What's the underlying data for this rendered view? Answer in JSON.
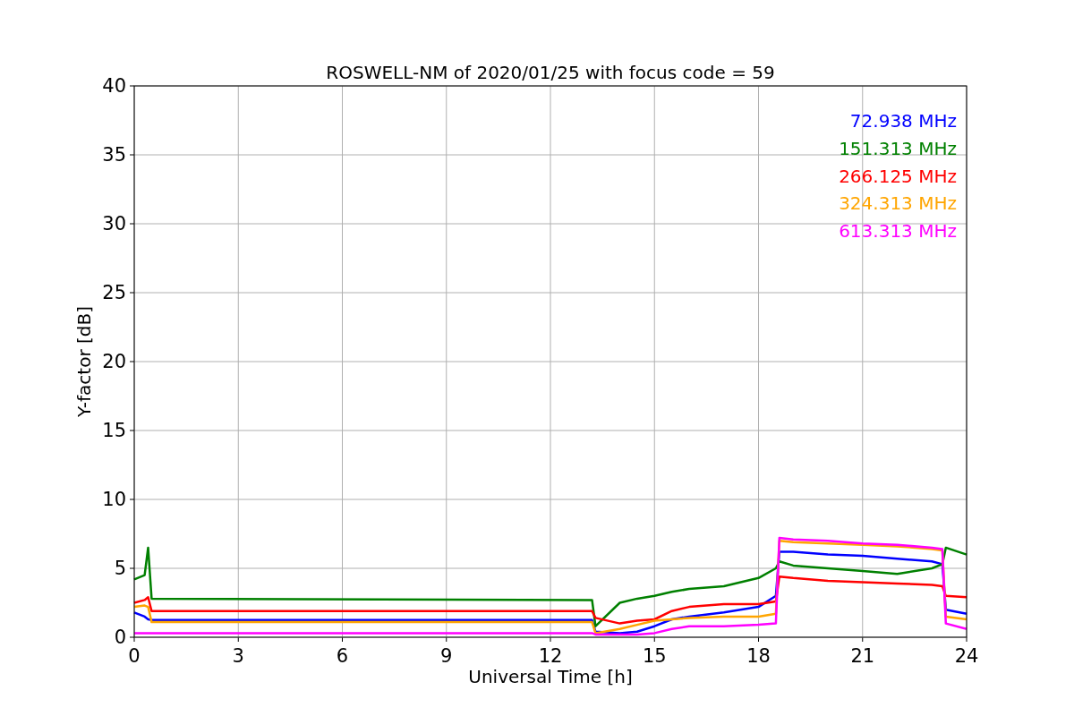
{
  "figure": {
    "chart_data": {
      "type": "line",
      "title": "ROSWELL-NM of 2020/01/25 with focus code = 59",
      "xlabel": "Universal Time [h]",
      "ylabel": "Y-factor [dB]",
      "x": [
        0,
        0.3,
        0.4,
        0.5,
        13.2,
        13.3,
        14,
        14.5,
        15,
        15.5,
        16,
        17,
        18,
        18.5,
        18.6,
        19,
        20,
        21,
        22,
        23,
        23.3,
        23.4,
        24
      ],
      "series": [
        {
          "name": "72.938 MHz",
          "color": "#0000ff",
          "values": [
            1.8,
            1.5,
            1.3,
            1.25,
            1.25,
            0.4,
            0.3,
            0.4,
            0.8,
            1.3,
            1.5,
            1.8,
            2.2,
            3.0,
            6.2,
            6.2,
            6.0,
            5.9,
            5.7,
            5.5,
            5.3,
            2.0,
            1.7
          ]
        },
        {
          "name": "151.313 MHz",
          "color": "#008000",
          "values": [
            4.2,
            4.5,
            6.5,
            2.8,
            2.7,
            0.8,
            2.5,
            2.8,
            3.0,
            3.3,
            3.5,
            3.7,
            4.3,
            5.0,
            5.5,
            5.2,
            5.0,
            4.8,
            4.6,
            5.0,
            5.3,
            6.5,
            6.0
          ]
        },
        {
          "name": "266.125 MHz",
          "color": "#ff0000",
          "values": [
            2.5,
            2.7,
            2.9,
            1.9,
            1.9,
            1.4,
            1.0,
            1.2,
            1.3,
            1.9,
            2.2,
            2.4,
            2.4,
            2.6,
            4.4,
            4.3,
            4.1,
            4.0,
            3.9,
            3.8,
            3.7,
            3.0,
            2.9
          ]
        },
        {
          "name": "324.313 MHz",
          "color": "#ffa500",
          "values": [
            2.2,
            2.3,
            2.2,
            1.1,
            1.1,
            0.3,
            0.6,
            0.9,
            1.2,
            1.3,
            1.4,
            1.5,
            1.5,
            1.7,
            7.0,
            6.9,
            6.8,
            6.7,
            6.6,
            6.4,
            6.3,
            1.5,
            1.3
          ]
        },
        {
          "name": "613.313 MHz",
          "color": "#ff00ff",
          "values": [
            0.3,
            0.3,
            0.3,
            0.3,
            0.3,
            0.2,
            0.2,
            0.2,
            0.3,
            0.6,
            0.8,
            0.8,
            0.9,
            1.0,
            7.2,
            7.1,
            7.0,
            6.8,
            6.7,
            6.5,
            6.4,
            1.0,
            0.6
          ]
        }
      ],
      "grid": true,
      "xlim": [
        0,
        24
      ],
      "ylim": [
        0,
        40
      ],
      "xticks": [
        0,
        3,
        6,
        9,
        12,
        15,
        18,
        21,
        24
      ],
      "yticks": [
        0,
        5,
        10,
        15,
        20,
        25,
        30,
        35,
        40
      ]
    }
  }
}
